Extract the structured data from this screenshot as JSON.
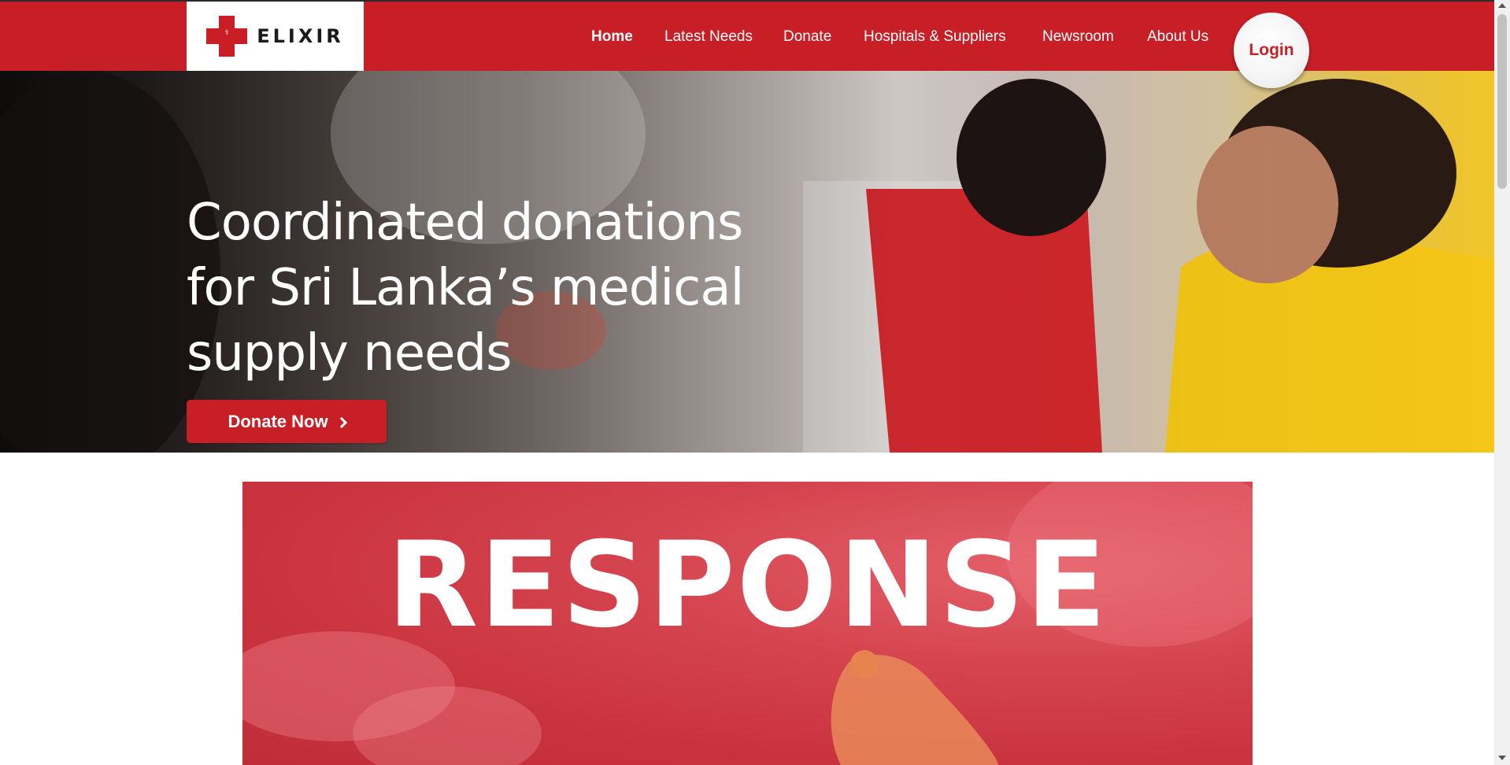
{
  "brand": {
    "name": "ELIXIR",
    "accent_color": "#c81f27",
    "logo_icon": "red-cross-icon"
  },
  "nav": {
    "items": [
      {
        "label": "Home",
        "active": true
      },
      {
        "label": "Latest Needs",
        "active": false
      },
      {
        "label": "Donate",
        "active": false
      },
      {
        "label": "Hospitals & Suppliers",
        "active": false
      },
      {
        "label": "Newsroom",
        "active": false
      },
      {
        "label": "About Us",
        "active": false
      }
    ],
    "login_label": "Login"
  },
  "hero": {
    "title": "Coordinated donations for Sri Lanka’s medical supply needs",
    "cta_label": "Donate Now",
    "cta_icon": "chevron-right-icon"
  },
  "banner": {
    "title": "RESPONSE"
  }
}
